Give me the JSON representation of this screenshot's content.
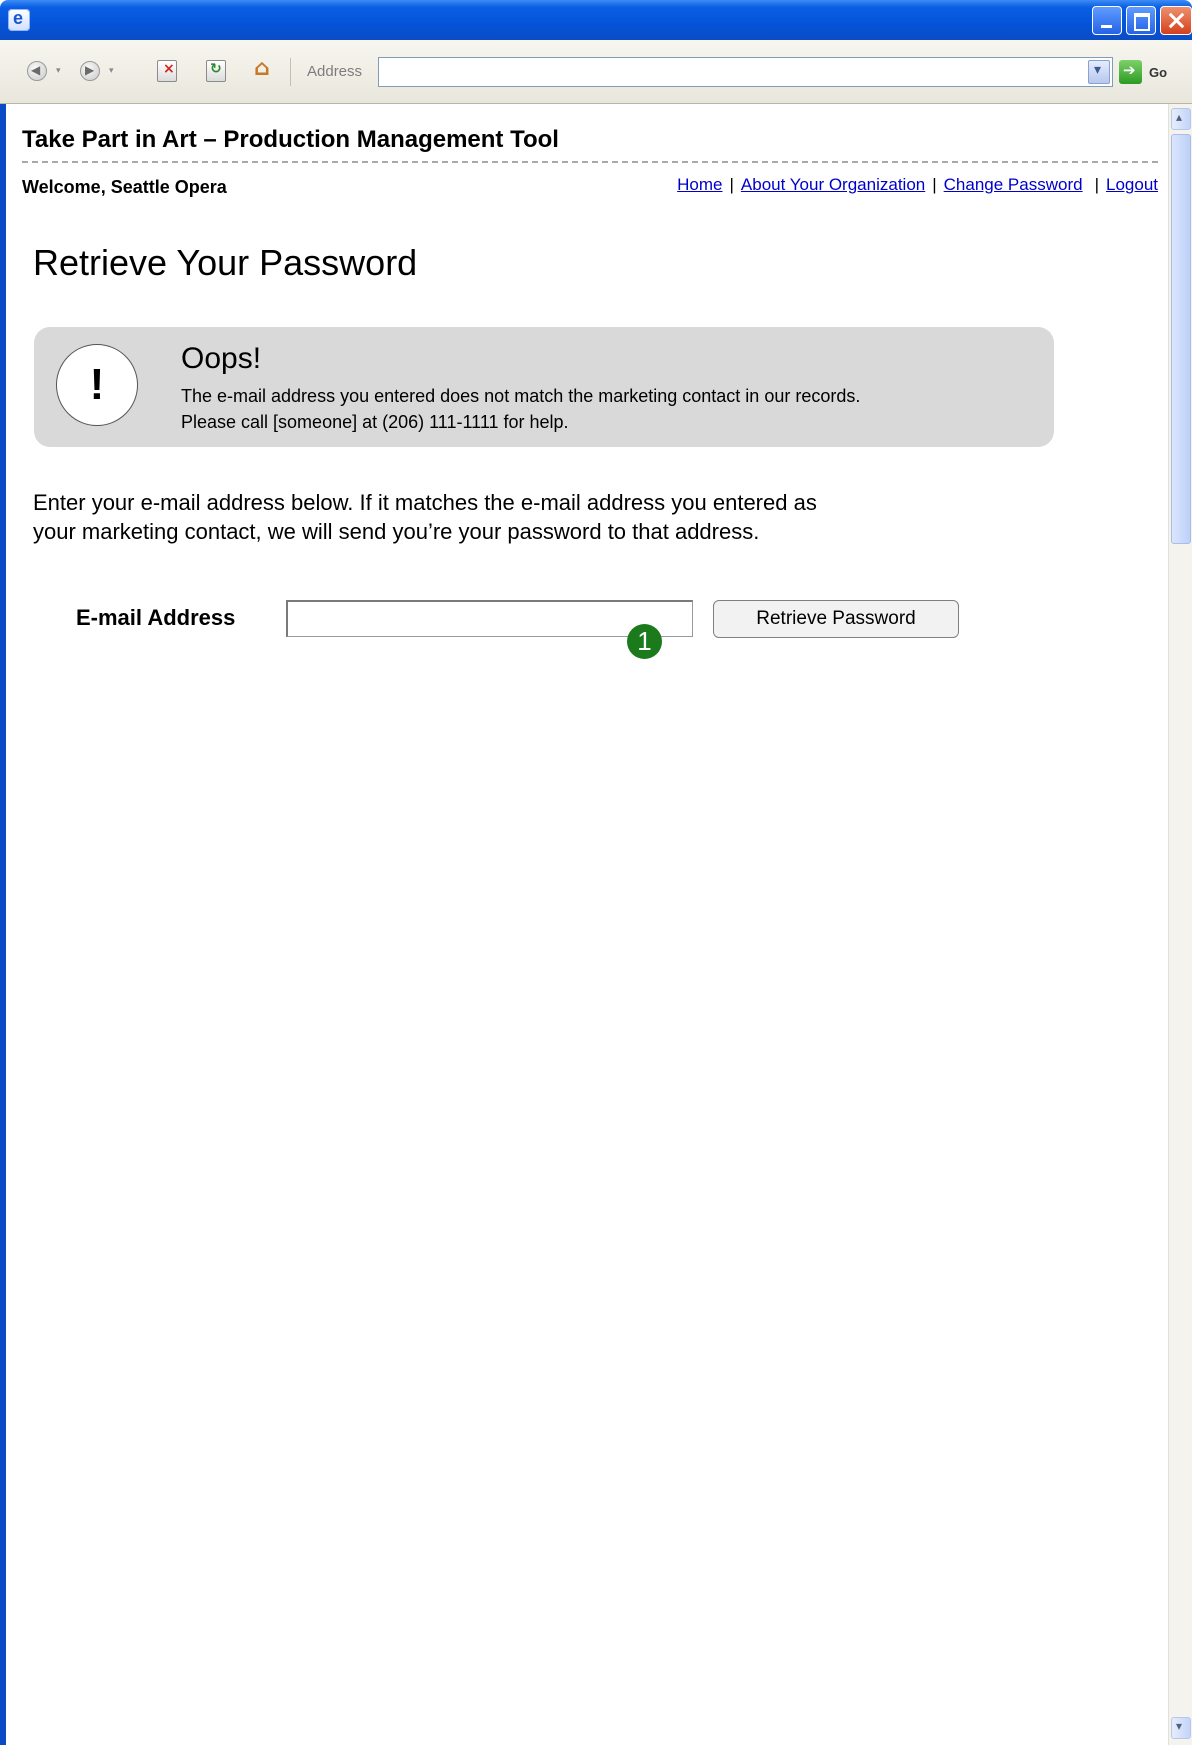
{
  "browser": {
    "address_label": "Address",
    "address_value": "",
    "go_label": "Go"
  },
  "site": {
    "title": "Take Part in Art – Production Management Tool",
    "welcome": "Welcome, Seattle Opera",
    "nav": {
      "home": "Home",
      "about": "About Your Organization",
      "change_password": "Change Password",
      "logout": "Logout",
      "separator": "|"
    }
  },
  "page": {
    "heading": "Retrieve Your Password",
    "alert": {
      "icon_symbol": "!",
      "title": "Oops!",
      "line1": "The e-mail address you entered does not match the marketing contact in our records.",
      "line2": "Please call [someone] at (206) 111-1111 for help."
    },
    "intro_line1": "Enter your e-mail address below. If it matches the e-mail address you entered as",
    "intro_line2": "your marketing contact, we will send you’re your password to that address.",
    "form": {
      "email_label": "E-mail Address",
      "email_value": "",
      "submit_label": "Retrieve Password"
    },
    "annotation_marker": "1"
  }
}
